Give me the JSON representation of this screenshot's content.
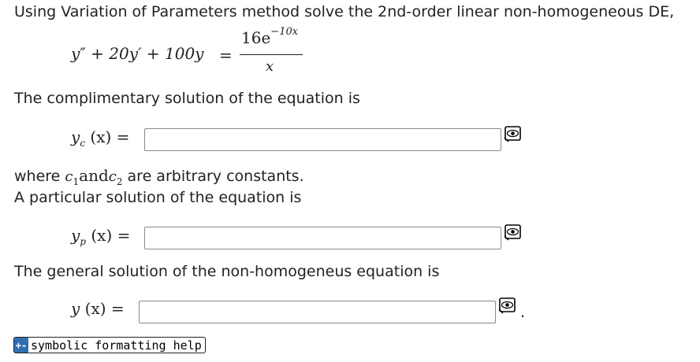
{
  "question": {
    "intro": "Using Variation of Parameters method solve the 2nd-order linear non-homogeneous DE,",
    "equation_lhs": "y″ + 20y′ + 100y",
    "equals": "=",
    "rhs_numerator": "16e",
    "rhs_exponent": "−10x",
    "rhs_denominator": "x",
    "complementary_text": "The complimentary solution of the equation is",
    "yc_label": "y",
    "yc_sub": "c",
    "arg": "(x)",
    "where_text": "where",
    "c1": "c",
    "c1_sub": "1",
    "and_word": "and",
    "c2": "c",
    "c2_sub": "2",
    "arbitrary_text": "are arbitrary constants.",
    "particular_text": "A particular solution of the equation is",
    "yp_label": "y",
    "yp_sub": "p",
    "general_text": "The general solution of the non-homogeneus equation is",
    "y_label": "y",
    "period": "."
  },
  "inputs": {
    "yc_value": "",
    "yp_value": "",
    "y_value": ""
  },
  "help": {
    "badge": "+-",
    "label": "symbolic formatting help"
  },
  "icons": {
    "preview": "eye-preview-icon"
  }
}
